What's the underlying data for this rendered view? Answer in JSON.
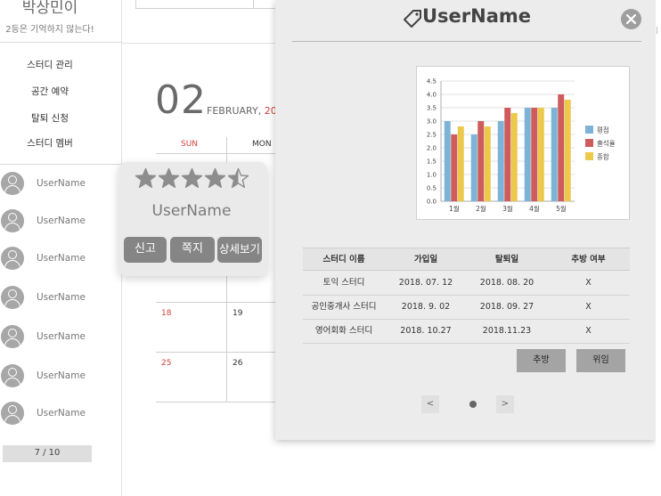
{
  "sidebar": {
    "title": "박상민이",
    "subtitle": "2등은 기억하지 않는다!",
    "menu": [
      {
        "label": "스터디 관리"
      },
      {
        "label": "공간 예약"
      },
      {
        "label": "탈퇴 신청"
      },
      {
        "label": "스터디 멤버"
      }
    ],
    "members": [
      {
        "name": "UserName"
      },
      {
        "name": "UserName"
      },
      {
        "name": "UserName"
      },
      {
        "name": "UserName"
      },
      {
        "name": "UserName"
      },
      {
        "name": "UserName"
      },
      {
        "name": "UserName"
      }
    ],
    "pager": "7 / 10"
  },
  "calendar": {
    "day": "02",
    "month": "FEBRUARY,",
    "year": "20",
    "dow_sun": "SUN",
    "dow_mon": "MON",
    "dates": [
      "18",
      "19",
      "25",
      "26"
    ]
  },
  "profile_popup": {
    "rating": 4.5,
    "rating_max": 5,
    "name": "UserName",
    "buttons": {
      "report": "신고",
      "message": "쪽지",
      "details": "상세보기"
    }
  },
  "modal": {
    "title": "UserName",
    "icon": "tag-icon",
    "close_icon": "close-icon",
    "table": {
      "headers": [
        "스터디 이름",
        "가입일",
        "탈퇴일",
        "추방 여부"
      ],
      "rows": [
        [
          "토익 스터디",
          "2018. 07. 12",
          "2018. 08. 20",
          "X"
        ],
        [
          "공인중개사 스터디",
          "2018. 9. 02",
          "2018. 09. 27",
          "X"
        ],
        [
          "영어회화 스터디",
          "2018. 10.27",
          "2018.11.23",
          "X"
        ]
      ]
    },
    "buttons": {
      "kick": "추방",
      "delegate": "위임"
    },
    "pagination": {
      "prev": "<",
      "next": ">",
      "current": 1,
      "total": 1
    }
  },
  "colors": {
    "series_1": "#7db3d6",
    "series_2": "#cf5c5c",
    "series_3": "#ecc94b",
    "accent_red": "#d1413b"
  },
  "chart_data": {
    "type": "bar",
    "categories": [
      "1월",
      "2월",
      "3월",
      "4월",
      "5월"
    ],
    "series": [
      {
        "name": "평점",
        "values": [
          3.0,
          2.5,
          3.0,
          3.5,
          3.5
        ]
      },
      {
        "name": "출석율",
        "values": [
          2.5,
          3.0,
          3.5,
          3.5,
          4.0
        ]
      },
      {
        "name": "종합",
        "values": [
          2.8,
          2.8,
          3.3,
          3.5,
          3.8
        ]
      }
    ],
    "ylim": [
      0,
      4.5
    ],
    "yticks": [
      "0.0",
      "0.5",
      "1.0",
      "1.5",
      "2.0",
      "2.5",
      "3.0",
      "3.5",
      "4.0",
      "4.5"
    ],
    "grid": true,
    "legend": "right",
    "title": "",
    "xlabel": "",
    "ylabel": ""
  }
}
